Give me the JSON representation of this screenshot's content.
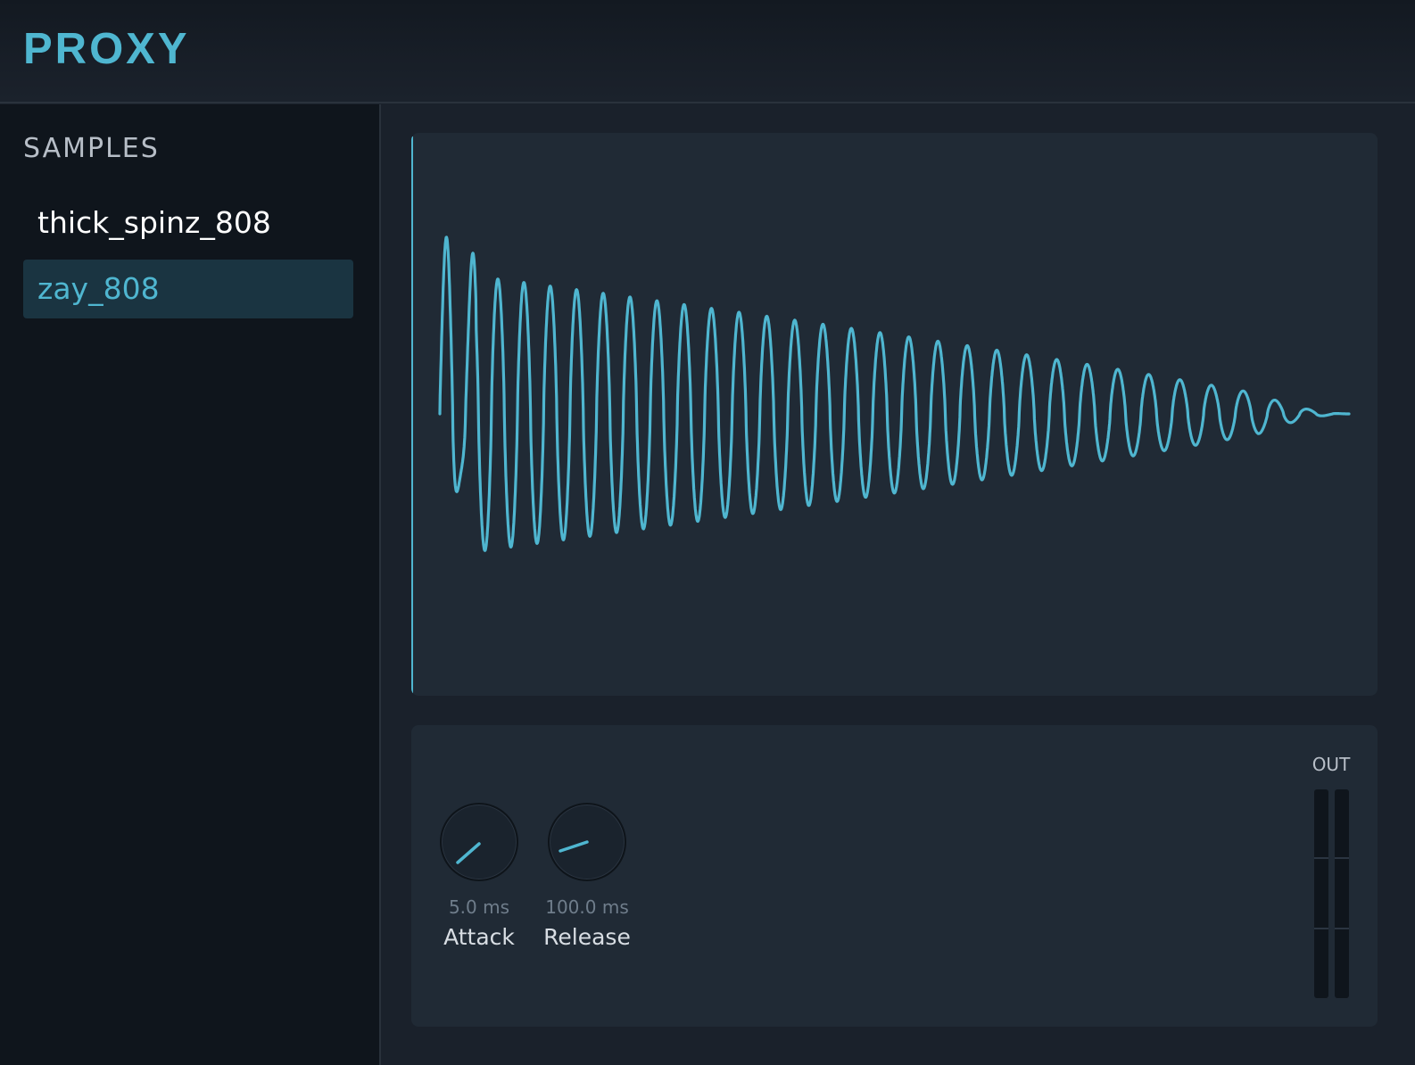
{
  "app": {
    "title": "PROXY"
  },
  "sidebar": {
    "heading": "SAMPLES",
    "items": [
      {
        "label": "thick_spinz_808",
        "active": false
      },
      {
        "label": "zay_808",
        "active": true
      }
    ]
  },
  "waveform": {
    "color": "#4fb6d0",
    "background": "#202a35"
  },
  "controls": {
    "attack": {
      "value": "5.0 ms",
      "label": "Attack"
    },
    "release": {
      "value": "100.0 ms",
      "label": "Release"
    }
  },
  "meter": {
    "label": "OUT",
    "left_level": 0,
    "right_level": 0
  },
  "colors": {
    "accent": "#4fb6d0",
    "sidebar_bg": "#0f151c",
    "panel_bg": "#202a35",
    "active_item_bg": "#1a3441"
  }
}
